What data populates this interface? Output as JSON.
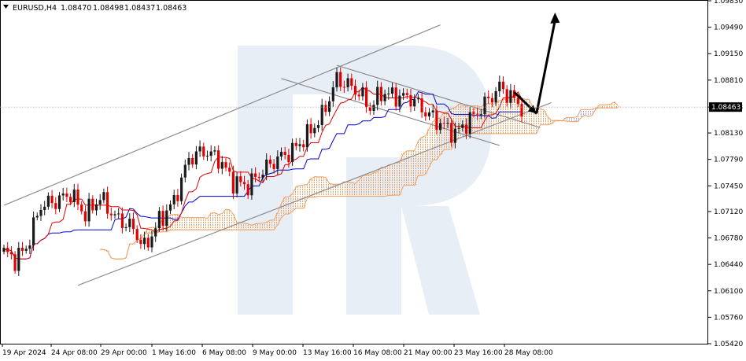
{
  "header": {
    "symbol": "EURUSD,H4",
    "open": "1.08470",
    "high": "1.08498",
    "low": "1.08437",
    "close": "1.08463"
  },
  "current_price_label": "1.08463",
  "colors": {
    "bull": "#1a1a1a",
    "bear": "#e00000",
    "tenkan": "#e00000",
    "kijun": "#0000c8",
    "cloud_bull": "#f0a060",
    "cloud_bear": "#b0a0d8",
    "channel": "#8c8c8c",
    "watermark": "#e8eef6",
    "arrow": "#000000"
  },
  "chart_data": {
    "type": "candlestick",
    "symbol": "EURUSD",
    "timeframe": "H4",
    "ylim": [
      1.0542,
      1.0983
    ],
    "y_ticks": [
      "1.09830",
      "1.09490",
      "1.09150",
      "1.08810",
      "1.08463",
      "1.08130",
      "1.07790",
      "1.07450",
      "1.07120",
      "1.06780",
      "1.06440",
      "1.06100",
      "1.05760",
      "1.05420"
    ],
    "x_ticks": [
      "19 Apr 2024",
      "24 Apr 08:00",
      "29 Apr 00:00",
      "1 May 16:00",
      "6 May 08:00",
      "9 May 00:00",
      "13 May 16:00",
      "16 May 08:00",
      "21 May 00:00",
      "23 May 16:00",
      "28 May 08:00"
    ],
    "anchors": [
      {
        "i": 0,
        "p": 1.066
      },
      {
        "i": 3,
        "p": 1.065
      },
      {
        "i": 6,
        "p": 1.0665
      },
      {
        "i": 10,
        "p": 1.072
      },
      {
        "i": 14,
        "p": 1.0725
      },
      {
        "i": 18,
        "p": 1.0735
      },
      {
        "i": 22,
        "p": 1.0708
      },
      {
        "i": 26,
        "p": 1.073
      },
      {
        "i": 30,
        "p": 1.0705
      },
      {
        "i": 35,
        "p": 1.069
      },
      {
        "i": 38,
        "p": 1.0665
      },
      {
        "i": 42,
        "p": 1.07
      },
      {
        "i": 46,
        "p": 1.0725
      },
      {
        "i": 50,
        "p": 1.078
      },
      {
        "i": 54,
        "p": 1.079
      },
      {
        "i": 58,
        "p": 1.078
      },
      {
        "i": 62,
        "p": 1.075
      },
      {
        "i": 66,
        "p": 1.0745
      },
      {
        "i": 70,
        "p": 1.0765
      },
      {
        "i": 74,
        "p": 1.078
      },
      {
        "i": 78,
        "p": 1.079
      },
      {
        "i": 82,
        "p": 1.081
      },
      {
        "i": 86,
        "p": 1.0835
      },
      {
        "i": 90,
        "p": 1.0882
      },
      {
        "i": 93,
        "p": 1.0875
      },
      {
        "i": 96,
        "p": 1.0865
      },
      {
        "i": 99,
        "p": 1.0845
      },
      {
        "i": 102,
        "p": 1.0865
      },
      {
        "i": 106,
        "p": 1.086
      },
      {
        "i": 110,
        "p": 1.0858
      },
      {
        "i": 114,
        "p": 1.084
      },
      {
        "i": 118,
        "p": 1.0825
      },
      {
        "i": 122,
        "p": 1.0812
      },
      {
        "i": 126,
        "p": 1.083
      },
      {
        "i": 130,
        "p": 1.085
      },
      {
        "i": 134,
        "p": 1.0872
      },
      {
        "i": 137,
        "p": 1.086
      },
      {
        "i": 140,
        "p": 1.0846
      }
    ],
    "channel_lines": [
      {
        "a": [
          0,
          1.072
        ],
        "b": [
          118,
          1.0952
        ]
      },
      {
        "a": [
          20,
          1.0617
        ],
        "b": [
          148,
          1.0852
        ]
      },
      {
        "a": [
          75,
          1.0883
        ],
        "b": [
          134,
          1.0797
        ]
      },
      {
        "a": [
          90,
          1.09
        ],
        "b": [
          145,
          1.082
        ]
      }
    ],
    "forecast_arrow": {
      "from": [
        141,
        1.0845
      ],
      "via": [
        144,
        1.0838
      ],
      "to": [
        149,
        1.0968
      ]
    }
  }
}
